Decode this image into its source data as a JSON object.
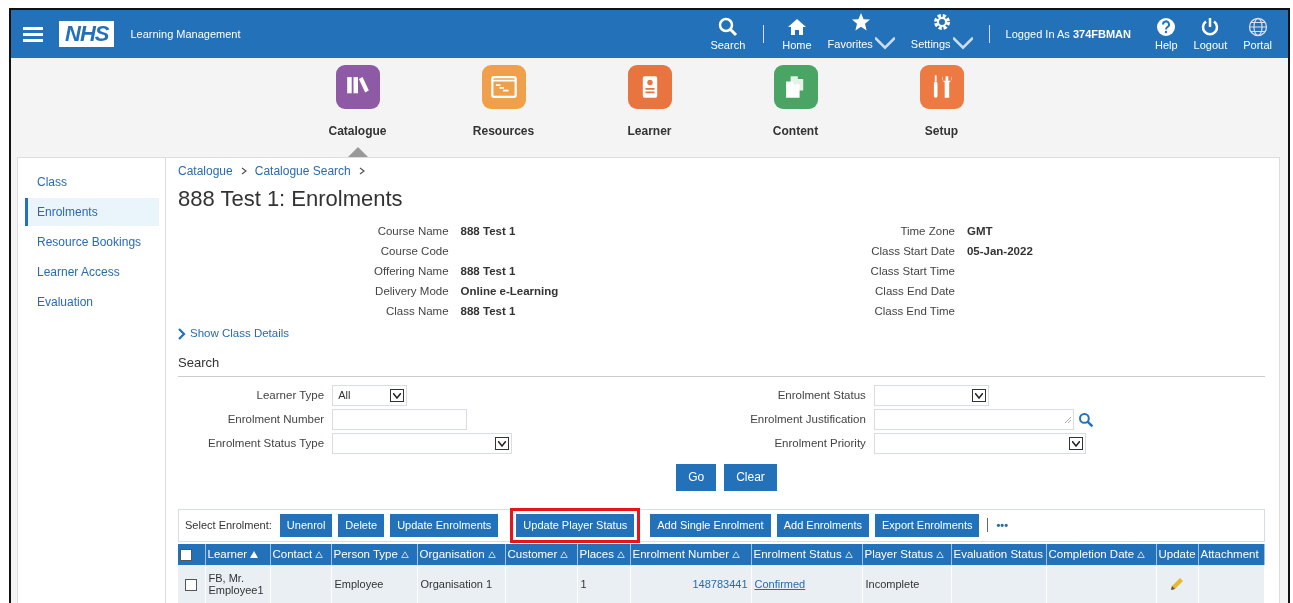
{
  "header": {
    "logo": "NHS",
    "app_title": "Learning Management",
    "nav": [
      {
        "label": "Search",
        "menu": false
      },
      {
        "label": "Home",
        "menu": false
      },
      {
        "label": "Favorites",
        "menu": true
      },
      {
        "label": "Settings",
        "menu": true
      }
    ],
    "logged_in_label": "Logged In As",
    "user": "374FBMAN",
    "utility": [
      {
        "label": "Help"
      },
      {
        "label": "Logout"
      },
      {
        "label": "Portal"
      }
    ]
  },
  "modules": [
    {
      "label": "Catalogue",
      "color": "#8e5aa6",
      "selected": true
    },
    {
      "label": "Resources",
      "color": "#f0a04b",
      "selected": false
    },
    {
      "label": "Learner",
      "color": "#e8743f",
      "selected": false
    },
    {
      "label": "Content",
      "color": "#4aa564",
      "selected": false
    },
    {
      "label": "Setup",
      "color": "#ec7a42",
      "selected": false
    }
  ],
  "sidebar": {
    "items": [
      {
        "label": "Class",
        "selected": false
      },
      {
        "label": "Enrolments",
        "selected": true
      },
      {
        "label": "Resource Bookings",
        "selected": false
      },
      {
        "label": "Learner Access",
        "selected": false
      },
      {
        "label": "Evaluation",
        "selected": false
      }
    ]
  },
  "breadcrumb": [
    "Catalogue",
    "Catalogue Search"
  ],
  "page_title": "888 Test 1: Enrolments",
  "details_left": [
    {
      "label": "Course Name",
      "value": "888 Test 1"
    },
    {
      "label": "Course Code"
    },
    {
      "label": "Offering Name",
      "value": "888 Test 1"
    },
    {
      "label": "Delivery Mode",
      "value": "Online e-Learning"
    },
    {
      "label": "Class Name",
      "value": "888 Test 1"
    }
  ],
  "details_right": [
    {
      "label": "Time Zone",
      "value": "GMT"
    },
    {
      "label": "Class Start Date",
      "value": "05-Jan-2022"
    },
    {
      "label": "Class Start Time"
    },
    {
      "label": "Class End Date"
    },
    {
      "label": "Class End Time"
    }
  ],
  "show_details": "Show Class Details",
  "search": {
    "title": "Search",
    "left": [
      {
        "label": "Learner Type",
        "kind": "select",
        "value": "All"
      },
      {
        "label": "Enrolment Number",
        "kind": "text"
      },
      {
        "label": "Enrolment Status Type",
        "kind": "select"
      }
    ],
    "right": [
      {
        "label": "Enrolment Status",
        "kind": "select"
      },
      {
        "label": "Enrolment Justification",
        "kind": "lookup"
      },
      {
        "label": "Enrolment Priority",
        "kind": "select"
      }
    ],
    "buttons": [
      "Go",
      "Clear"
    ]
  },
  "toolbar": {
    "label": "Select Enrolment:",
    "buttons": [
      {
        "label": "Unenrol",
        "highlighted": false
      },
      {
        "label": "Delete",
        "highlighted": false
      },
      {
        "label": "Update Enrolments",
        "highlighted": false
      },
      {
        "label": "Update Player Status",
        "highlighted": true
      },
      {
        "label": "Add Single Enrolment",
        "highlighted": false
      },
      {
        "label": "Add Enrolments",
        "highlighted": false
      },
      {
        "label": "Export Enrolments",
        "highlighted": false
      }
    ],
    "more": "•••"
  },
  "table": {
    "select_all": false,
    "columns": [
      {
        "label": "Learner",
        "sortable": true,
        "sorted": true
      },
      {
        "label": "Contact",
        "sortable": true,
        "sorted": false
      },
      {
        "label": "Person Type",
        "sortable": true,
        "sorted": false
      },
      {
        "label": "Organisation",
        "sortable": true,
        "sorted": false
      },
      {
        "label": "Customer",
        "sortable": true,
        "sorted": false
      },
      {
        "label": "Places",
        "sortable": true,
        "sorted": false
      },
      {
        "label": "Enrolment Number",
        "sortable": true,
        "sorted": false
      },
      {
        "label": "Enrolment Status",
        "sortable": true,
        "sorted": false
      },
      {
        "label": "Player Status",
        "sortable": true,
        "sorted": false
      },
      {
        "label": "Evaluation Status",
        "sortable": false
      },
      {
        "label": "Completion Date",
        "sortable": true,
        "sorted": false
      },
      {
        "label": "Update",
        "sortable": false
      },
      {
        "label": "Attachment",
        "sortable": false
      }
    ],
    "rows": [
      {
        "checked": false,
        "cells": [
          {
            "kind": "text",
            "text": "FB, Mr. Employee1"
          },
          {
            "kind": "empty"
          },
          {
            "kind": "text",
            "text": "Employee"
          },
          {
            "kind": "text",
            "text": "Organisation 1"
          },
          {
            "kind": "empty"
          },
          {
            "kind": "text",
            "text": "1"
          },
          {
            "kind": "number_link",
            "text": "148783441"
          },
          {
            "kind": "link",
            "text": "Confirmed"
          },
          {
            "kind": "text",
            "text": "Incomplete"
          },
          {
            "kind": "empty"
          },
          {
            "kind": "empty"
          },
          {
            "kind": "edit"
          },
          {
            "kind": "empty"
          }
        ]
      }
    ]
  }
}
